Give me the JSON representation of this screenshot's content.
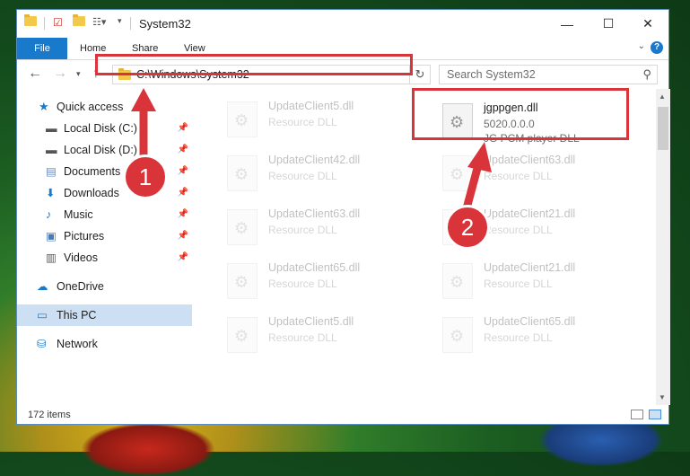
{
  "window": {
    "title": "System32",
    "controls": {
      "minimize": "—",
      "maximize": "☐",
      "close": "✕"
    }
  },
  "ribbon": {
    "tabs": [
      "File",
      "Home",
      "Share",
      "View"
    ],
    "help": "?"
  },
  "address": {
    "path": "C:\\Windows\\System32",
    "search_placeholder": "Search System32"
  },
  "sidebar": {
    "items": [
      {
        "label": "Quick access",
        "icon": "star-icon",
        "pinned": false
      },
      {
        "label": "Local Disk (C:)",
        "icon": "drive-icon",
        "pinned": true
      },
      {
        "label": "Local Disk (D:)",
        "icon": "drive-icon",
        "pinned": true
      },
      {
        "label": "Documents",
        "icon": "documents-icon",
        "pinned": true
      },
      {
        "label": "Downloads",
        "icon": "download-icon",
        "pinned": true
      },
      {
        "label": "Music",
        "icon": "music-icon",
        "pinned": true
      },
      {
        "label": "Pictures",
        "icon": "pictures-icon",
        "pinned": true
      },
      {
        "label": "Videos",
        "icon": "videos-icon",
        "pinned": true
      },
      {
        "label": "OneDrive",
        "icon": "cloud-icon",
        "pinned": false
      },
      {
        "label": "This PC",
        "icon": "computer-icon",
        "pinned": false,
        "selected": true
      },
      {
        "label": "Network",
        "icon": "network-icon",
        "pinned": false
      }
    ]
  },
  "files": {
    "highlighted": {
      "name": "jgppgen.dll",
      "version": "5020.0.0.0",
      "description": "JG PCM player DLL"
    },
    "left_column": [
      {
        "name": "UpdateClient5.dll",
        "desc": "Resource DLL"
      },
      {
        "name": "UpdateClient42.dll",
        "desc": "Resource DLL"
      },
      {
        "name": "UpdateClient63.dll",
        "desc": "Resource DLL"
      },
      {
        "name": "UpdateClient65.dll",
        "desc": "Resource DLL"
      },
      {
        "name": "UpdateClient5.dll",
        "desc": "Resource DLL"
      }
    ],
    "right_column": [
      {
        "name": "UpdateClient63.dll",
        "desc": "Resource DLL"
      },
      {
        "name": "UpdateClient21.dll",
        "desc": "Resource DLL"
      },
      {
        "name": "UpdateClient21.dll",
        "desc": "Resource DLL"
      },
      {
        "name": "UpdateClient65.dll",
        "desc": "Resource DLL"
      }
    ]
  },
  "status": {
    "items": "172 items"
  },
  "callouts": {
    "one": "1",
    "two": "2"
  },
  "colors": {
    "accent": "#1979ca",
    "highlight": "#d9343a",
    "selected": "#ccdff3"
  }
}
